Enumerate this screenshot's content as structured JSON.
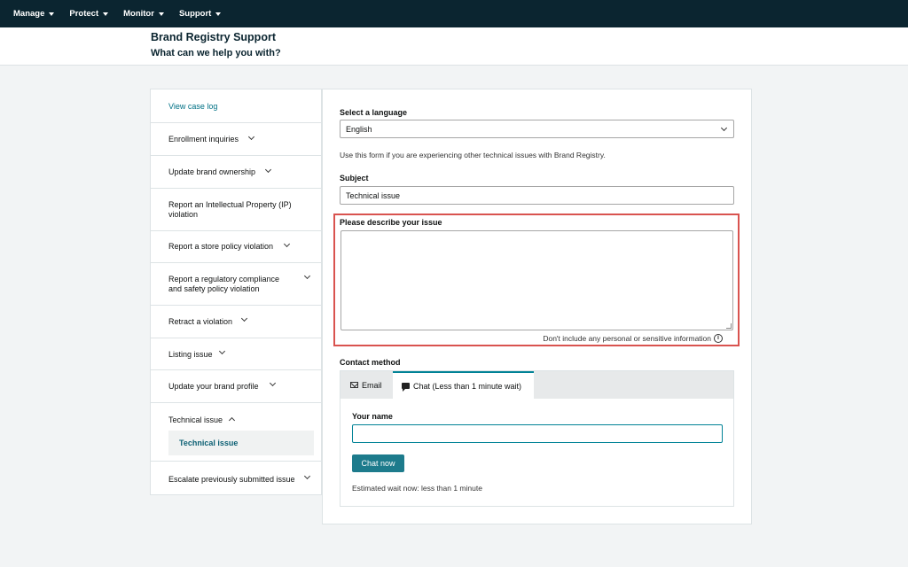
{
  "nav": {
    "items": [
      {
        "label": "Manage"
      },
      {
        "label": "Protect"
      },
      {
        "label": "Monitor"
      },
      {
        "label": "Support"
      }
    ]
  },
  "header": {
    "title": "Brand Registry Support",
    "subtitle": "What can we help you with?"
  },
  "sidebar": {
    "items": [
      {
        "label": "View case log"
      },
      {
        "label": "Enrollment inquiries"
      },
      {
        "label": "Update brand ownership"
      },
      {
        "label": "Report an Intellectual Property (IP) violation"
      },
      {
        "label": "Report a store policy violation"
      },
      {
        "label": "Report a regulatory compliance and safety policy violation"
      },
      {
        "label": "Retract a violation"
      },
      {
        "label": "Listing issue"
      },
      {
        "label": "Update your brand profile"
      },
      {
        "label": "Technical issue"
      },
      {
        "label": "Escalate previously submitted issue"
      }
    ],
    "sub_selected": "Technical issue"
  },
  "form": {
    "language_label": "Select a language",
    "language_value": "English",
    "help_text": "Use this form if you are experiencing other technical issues with Brand Registry.",
    "subject_label": "Subject",
    "subject_value": "Technical issue",
    "describe_label": "Please describe your issue",
    "describe_value": "",
    "privacy_note": "Don't include any personal or sensitive information",
    "contact_label": "Contact method",
    "tabs": [
      {
        "label": "Email"
      },
      {
        "label": "Chat (Less than 1 minute wait)"
      }
    ],
    "name_label": "Your name",
    "name_value": "",
    "chat_button": "Chat now",
    "wait_text": "Estimated wait now: less than 1 minute"
  },
  "colors": {
    "nav_bg": "#0b2530",
    "accent": "#008296",
    "highlight": "#d9534f",
    "link": "#007185"
  },
  "icons": [
    "caret-down-icon",
    "chevron-down-icon",
    "chevron-up-icon",
    "info-icon",
    "envelope-icon",
    "chat-bubble-icon",
    "resize-handle-icon"
  ]
}
